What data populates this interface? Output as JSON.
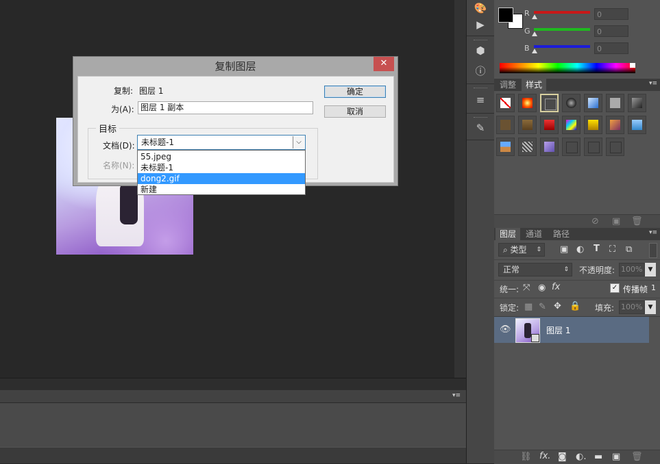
{
  "dialog": {
    "title": "复制图层",
    "close_glyph": "✕",
    "copy_label": "复制:",
    "copy_value": "图层 1",
    "as_label": "为(A):",
    "as_value": "图层 1 副本",
    "ok_label": "确定",
    "cancel_label": "取消",
    "group_label": "目标",
    "document_label": "文档(D):",
    "document_value": "未标题-1",
    "name_label": "名称(N):",
    "dropdown_options": [
      "55.jpeg",
      "未标题-1",
      "dong2.gif",
      "新建"
    ],
    "highlighted_option": "dong2.gif"
  },
  "color_panel": {
    "r_label": "R",
    "g_label": "G",
    "b_label": "B",
    "r_value": "0",
    "g_value": "0",
    "b_value": "0",
    "slider_colors": {
      "r": "#e02020",
      "g": "#20c020",
      "b": "#2020e0"
    }
  },
  "styles_panel": {
    "tabs": [
      "调整",
      "样式"
    ],
    "active_tab": "样式"
  },
  "layers_panel": {
    "tabs": [
      "图层",
      "通道",
      "路径"
    ],
    "active_tab": "图层",
    "filter_kind": "类型",
    "blend_mode": "正常",
    "opacity_label": "不透明度:",
    "opacity_value": "100%",
    "unify_label": "统一:",
    "propagate_label": "传播帧",
    "propagate_value": "1",
    "lock_label": "锁定:",
    "fill_label": "填充:",
    "fill_value": "100%",
    "layers": [
      {
        "name": "图层 1",
        "visible": true,
        "selected": true
      }
    ]
  },
  "colors": {
    "accent_blue": "#3399ff",
    "close_red": "#c75050",
    "selected_layer": "#5a6b82"
  }
}
